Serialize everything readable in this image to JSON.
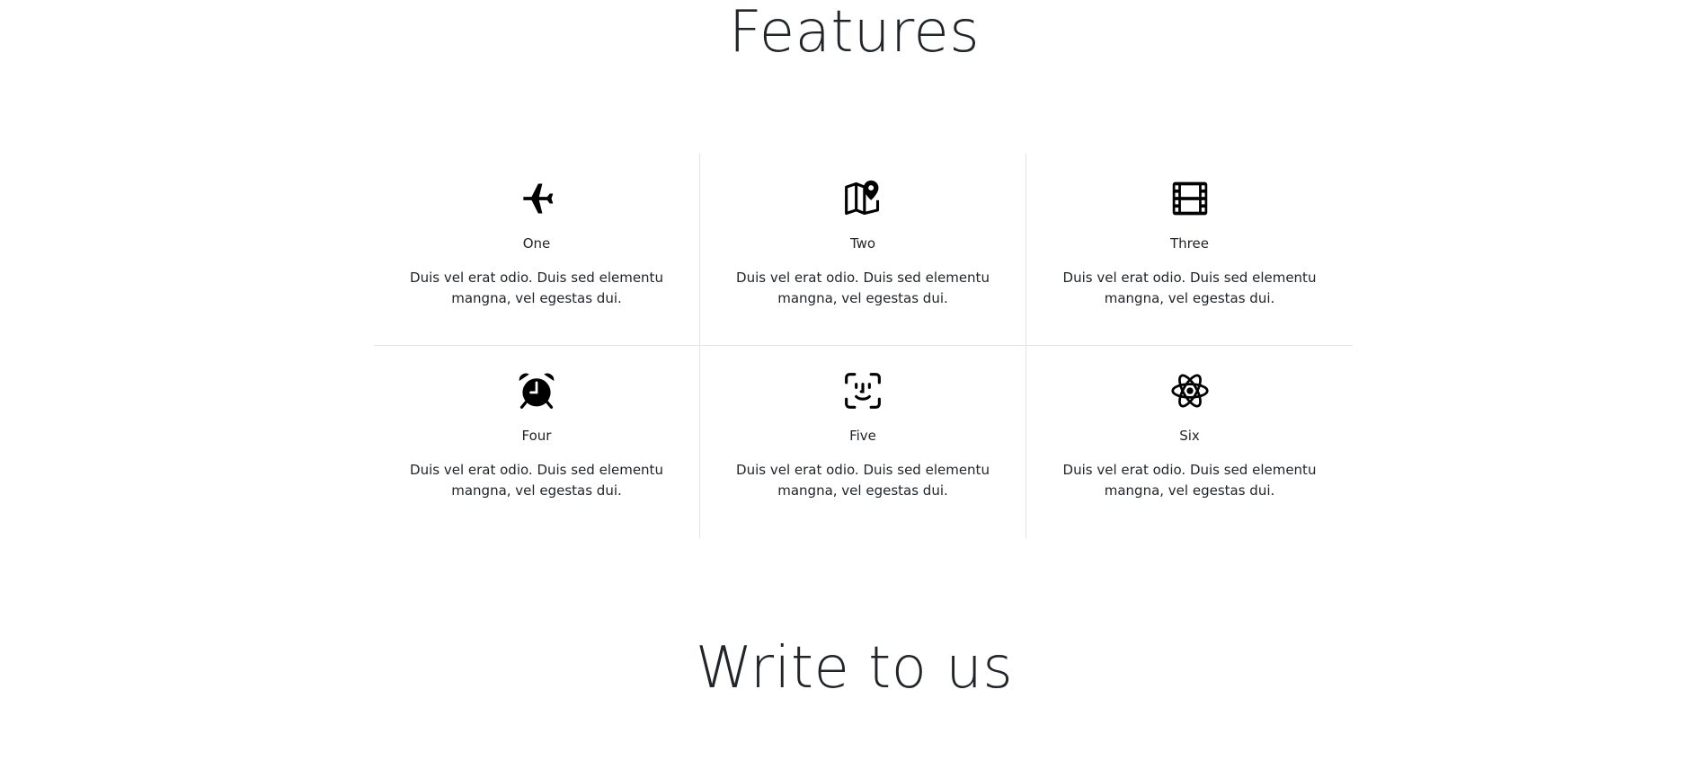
{
  "sections": {
    "features_title": "Features",
    "write_title": "Write to us"
  },
  "features": [
    {
      "name": "One",
      "icon": "airplane-icon",
      "desc": "Duis vel erat odio. Duis sed elementu mangna, vel egestas dui."
    },
    {
      "name": "Two",
      "icon": "map-pin-icon",
      "desc": "Duis vel erat odio. Duis sed elementu mangna, vel egestas dui."
    },
    {
      "name": "Three",
      "icon": "film-icon",
      "desc": "Duis vel erat odio. Duis sed elementu mangna, vel egestas dui."
    },
    {
      "name": "Four",
      "icon": "alarm-clock-icon",
      "desc": "Duis vel erat odio. Duis sed elementu mangna, vel egestas dui."
    },
    {
      "name": "Five",
      "icon": "face-id-icon",
      "desc": "Duis vel erat odio. Duis sed elementu mangna, vel egestas dui."
    },
    {
      "name": "Six",
      "icon": "atom-icon",
      "desc": "Duis vel erat odio. Duis sed elementu mangna, vel egestas dui."
    }
  ],
  "colors": {
    "text": "#212529",
    "divider": "#e3e3e3",
    "icon": "#000000"
  }
}
